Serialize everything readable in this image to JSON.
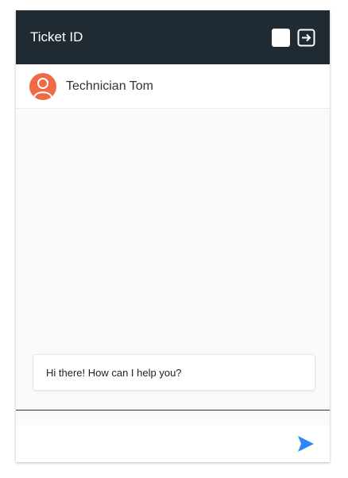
{
  "header": {
    "title": "Ticket ID",
    "background": "#1f2a33",
    "square_icon": "square-icon",
    "exit_icon": "exit-icon"
  },
  "agent": {
    "name": "Technician Tom",
    "avatar_icon": "user-avatar-icon",
    "avatar_color": "#f06a45"
  },
  "messages": [
    {
      "text": "Hi there! How can I help you?"
    }
  ],
  "composer": {
    "value": "",
    "placeholder": "",
    "send_icon": "send-icon",
    "accent": "#2f86f6"
  }
}
